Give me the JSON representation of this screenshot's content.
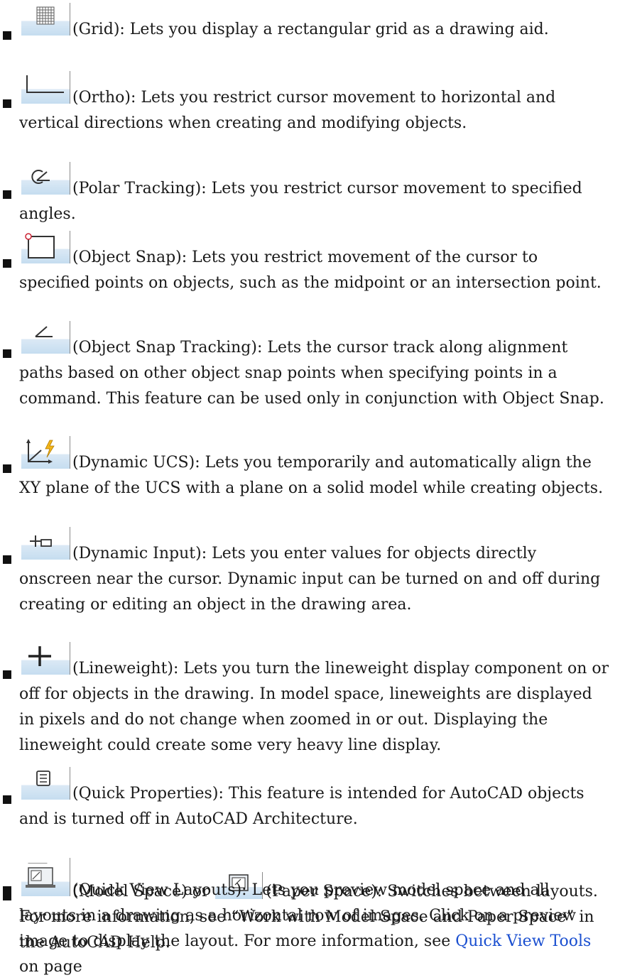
{
  "items": [
    {
      "name": "Grid",
      "rest": ": Lets you display a rectangular grid as a drawing aid."
    },
    {
      "name": "Ortho",
      "rest": ": Lets you restrict cursor movement to horizontal and vertical directions when creating and modifying objects."
    },
    {
      "name": "Polar Tracking",
      "rest": ": Lets you restrict cursor movement to specified angles."
    },
    {
      "name": "Object Snap",
      "rest": ": Lets you restrict movement of the cursor to specified points on objects, such as the midpoint or an intersection point."
    },
    {
      "name": "Object Snap Tracking",
      "rest": ": Lets the cursor track along alignment paths based on other object snap points when specifying points in a command. This feature can be used only in conjunction with Object Snap."
    },
    {
      "name": "Dynamic UCS",
      "rest": ": Lets you temporarily and automatically align the XY plane of the UCS with a plane on a solid model while creating objects."
    },
    {
      "name": "Dynamic Input",
      "rest": ": Lets you enter values for objects directly onscreen near the cursor. Dynamic input can be turned on and off during creating or editing an object in the drawing area."
    },
    {
      "name": "Lineweight",
      "rest": ": Lets you turn the lineweight display component on or off for objects in the drawing. In model space, lineweights are displayed in pixels and do not change when zoomed in or out. Displaying the lineweight could create some very heavy line display."
    },
    {
      "name": "Quick Properties",
      "rest": ": This feature is intended for AutoCAD objects and is turned off in AutoCAD Architecture."
    },
    {
      "name": "Model Space",
      "or": " or ",
      "name2": "Paper Space",
      "rest": ": Switches between layouts. For more information, see “Work with Model Space and Paper Space” in the AutoCAD Help."
    },
    {
      "name": "Quick View Layouts",
      "rest": ": Lets you preview model space and all layouts in a drawing as a horizontal row of images. Click on a preview image to display the layout. For more information, see ",
      "link": "Quick View Tools",
      "tail": " on page"
    }
  ],
  "icons": {
    "grid": "grid-icon",
    "ortho": "ortho-icon",
    "polar": "polar-tracking-icon",
    "osnap": "object-snap-icon",
    "otrack": "object-snap-tracking-icon",
    "ducs": "dynamic-ucs-icon",
    "dyn": "dynamic-input-icon",
    "lwt": "lineweight-icon",
    "qp": "quick-properties-icon",
    "model": "model-space-icon",
    "paper": "paper-space-icon",
    "qvl": "quick-view-layouts-icon"
  },
  "colors": {
    "link": "#1a4fd0",
    "icon_tint": "#c5ddf0"
  }
}
